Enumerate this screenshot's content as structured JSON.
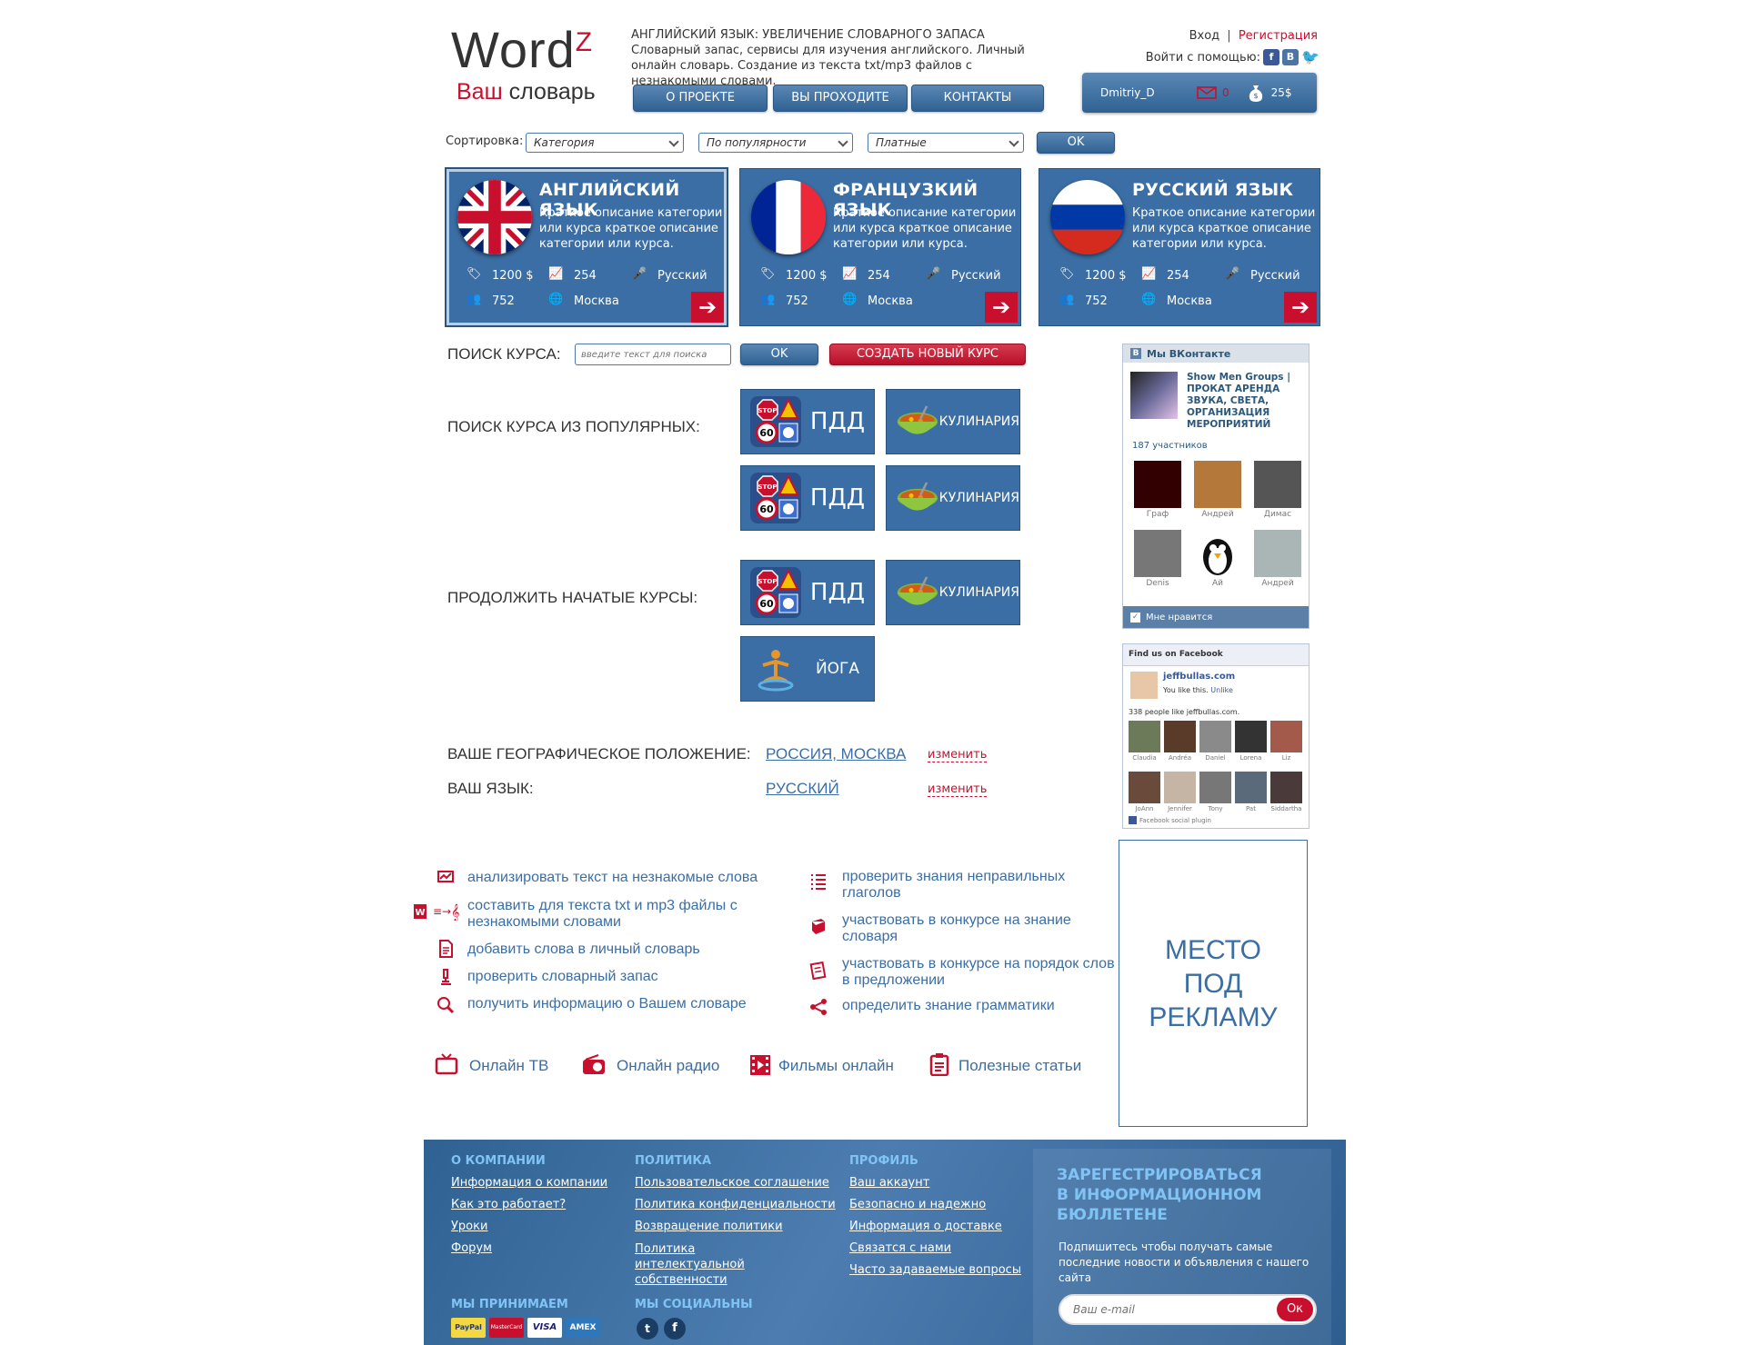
{
  "header": {
    "logo_word": "Word",
    "logo_sup": "Z",
    "logo_sub_red": "Ваш",
    "logo_sub_rest": " словарь",
    "title": "АНГЛИЙСКИЙ ЯЗЫК: УВЕЛИЧЕНИЕ СЛОВАРНОГО ЗАПАСА",
    "description": "Словарный запас, сервисы для изучения английского. Личный онлайн словарь. Создание из текста txt/mp3 файлов с незнакомыми словами.",
    "nav": [
      "О ПРОЕКТЕ",
      "ВЫ ПРОХОДИТЕ",
      "КОНТАКТЫ"
    ],
    "login": "Вход",
    "separator": "|",
    "register": "Регистрация",
    "login_with": "Войти с помощью:",
    "social_icons": [
      "facebook-icon",
      "vkontakte-icon",
      "twitter-icon"
    ]
  },
  "user": {
    "name": "Dmitriy_D",
    "messages": "0",
    "balance": "25$"
  },
  "sorting": {
    "label": "Сортировка:",
    "category": "Категория",
    "popularity": "По популярности",
    "paid": "Платные",
    "ok": "OK"
  },
  "cards": [
    {
      "title": "АНГЛИЙСКИЙ ЯЗЫК",
      "desc": "Краткое описание категории или курса краткое описание категории или курса.",
      "price": "1200 $",
      "views": "254",
      "lang": "Русский",
      "users": "752",
      "city": "Москва",
      "flag": "uk"
    },
    {
      "title": "ФРАНЦУЗКИЙ ЯЗЫК",
      "desc": "Краткое описание категории или курса краткое описание категории или курса.",
      "price": "1200 $",
      "views": "254",
      "lang": "Русский",
      "users": "752",
      "city": "Москва",
      "flag": "fr"
    },
    {
      "title": "РУССКИЙ ЯЗЫК",
      "desc": "Краткое описание категории или курса краткое описание категории или курса.",
      "price": "1200 $",
      "views": "254",
      "lang": "Русский",
      "users": "752",
      "city": "Москва",
      "flag": "ru"
    }
  ],
  "search": {
    "label": "ПОИСК КУРСА:",
    "placeholder": "введите текст для поиска",
    "ok": "OK",
    "create": "СОЗДАТЬ НОВЫЙ КУРС"
  },
  "popular": {
    "label": "ПОИСК КУРСА ИЗ ПОПУЛЯРНЫХ:",
    "tiles": [
      "ПДД",
      "КУЛИНАРИЯ",
      "ПДД",
      "КУЛИНАРИЯ"
    ]
  },
  "continue": {
    "label": "ПРОДОЛЖИТЬ НАЧАТЫЕ КУРСЫ:",
    "tiles": [
      "ПДД",
      "КУЛИНАРИЯ",
      "ЙОГА"
    ]
  },
  "geo": {
    "label": "ВАШЕ ГЕОГРАФИЧЕСКОЕ ПОЛОЖЕНИЕ:",
    "value": "РОССИЯ, МОСКВА",
    "change": "изменить"
  },
  "language": {
    "label": "ВАШ ЯЗЫК:",
    "value": "РУССКИЙ",
    "change": "изменить"
  },
  "features_left": [
    "анализировать текст на незнакомые слова",
    "составить для текста txt и mp3 файлы с незнакомыми словами",
    "добавить слова в личный словарь",
    "проверить словарный запас",
    "получить информацию о Вашем словаре"
  ],
  "features_right": [
    "проверить знания неправильных глаголов",
    "участвовать в конкурсе на знание словаря",
    "участвовать в конкурсе на порядок слов в предложении",
    "определить знание грамматики"
  ],
  "media": [
    "Онлайн ТВ",
    "Онлайн радио",
    "Фильмы онлайн",
    "Полезные статьи"
  ],
  "vk": {
    "header": "Мы ВКонтакте",
    "group": "Show Men Groups | ПРОКАТ АРЕНДА ЗВУКА, СВЕТА, ОРГАНИЗАЦИЯ МЕРОПРИЯТИЙ",
    "members": "187 участников",
    "people": [
      "Граф",
      "Андрей",
      "Димас",
      "Denis",
      "Ай",
      "Андрей"
    ],
    "like": "Мне нравится"
  },
  "fb": {
    "header": "Find us on Facebook",
    "page": "jeffbullas.com",
    "you_like": "You like this.",
    "unlike": "Unlike",
    "count": "338 people like jeffbullas.com.",
    "people": [
      "Claudia",
      "Andréa",
      "Daniel",
      "Lorena",
      "Liz",
      "JoAnn",
      "Jennifer",
      "Tony",
      "Pat",
      "Siddartha"
    ],
    "plugin": "Facebook social plugin"
  },
  "ad": {
    "text": "МЕСТО ПОД РЕКЛАМУ"
  },
  "footer": {
    "col1": {
      "title": "О КОМПАНИИ",
      "links": [
        "Информация о компании",
        "Как это работает?",
        "Уроки",
        "Форум"
      ]
    },
    "col2": {
      "title": "ПОЛИТИКА",
      "links": [
        "Пользовательское соглашение",
        "Политика конфиденциальности",
        "Возвращение политики",
        "Политика интелектуальной собственности"
      ]
    },
    "col3": {
      "title": "ПРОФИЛЬ",
      "links": [
        "Ваш аккаунт",
        "Безопасно и надежно",
        "Информация о доставке",
        "Связатся с нами",
        "Часто задаваемые вопросы"
      ]
    },
    "accept": "МЫ ПРИНИМАЕМ",
    "payments": [
      "PayPal",
      "MasterCard",
      "VISA",
      "AMEX"
    ],
    "social": "МЫ СОЦИАЛЬНЫ",
    "subscribe_title": "ЗАРЕГЕСТРИРОВАТЬСЯ В ИНФОРМАЦИОННОМ БЮЛЛЕТЕНЕ",
    "subscribe_text": "Подпишитесь чтобы получать самые последние новости и объявления с нашего сайта",
    "email_placeholder": "Ваш e-mail",
    "subscribe_btn": "Ок"
  },
  "colors": {
    "brand_blue": "#3b6ea4",
    "accent_red": "#c8102e",
    "footer_heading": "#7fc4f5"
  }
}
